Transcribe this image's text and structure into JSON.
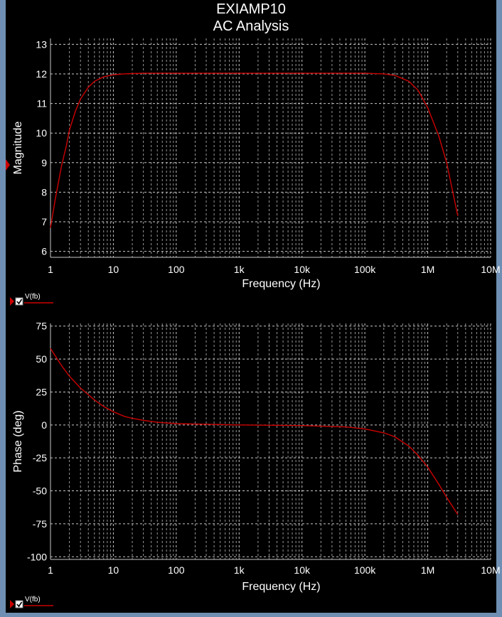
{
  "window": {
    "title": "EXIAMP10",
    "subtitle": "AC Analysis"
  },
  "colors": {
    "background": "#000000",
    "grid": "#c8c8c8",
    "trace": "#cc0000",
    "text": "#ffffff",
    "window_border": "#6e8fb3"
  },
  "chart_data": [
    {
      "type": "line",
      "xlabel": "Frequency (Hz)",
      "ylabel": "Magnitude",
      "xscale": "log",
      "xlim": [
        1,
        10000000
      ],
      "ylim": [
        5.8,
        13.2
      ],
      "x_ticks": [
        {
          "value": 1,
          "label": "1"
        },
        {
          "value": 10,
          "label": "10"
        },
        {
          "value": 100,
          "label": "100"
        },
        {
          "value": 1000,
          "label": "1k"
        },
        {
          "value": 10000,
          "label": "10k"
        },
        {
          "value": 100000,
          "label": "100k"
        },
        {
          "value": 1000000,
          "label": "1M"
        },
        {
          "value": 10000000,
          "label": "10M"
        }
      ],
      "y_ticks": [
        {
          "value": 6,
          "label": "6"
        },
        {
          "value": 7,
          "label": "7"
        },
        {
          "value": 8,
          "label": "8"
        },
        {
          "value": 9,
          "label": "9"
        },
        {
          "value": 10,
          "label": "10"
        },
        {
          "value": 11,
          "label": "11"
        },
        {
          "value": 12,
          "label": "12"
        },
        {
          "value": 13,
          "label": "13"
        }
      ],
      "grid": true,
      "legend_position": "bottom-left",
      "series": [
        {
          "name": "V(fb)",
          "x": [
            1,
            1.2,
            1.5,
            1.8,
            2,
            2.5,
            3,
            4,
            5,
            7,
            10,
            15,
            20,
            30,
            100,
            1000,
            10000,
            100000,
            200000,
            300000,
            500000,
            700000,
            1000000,
            1500000,
            2000000,
            2500000,
            3000000
          ],
          "y": [
            6.8,
            7.8,
            8.9,
            9.6,
            10.1,
            10.75,
            11.15,
            11.55,
            11.75,
            11.9,
            11.97,
            12.0,
            12.01,
            12.02,
            12.02,
            12.02,
            12.02,
            12.02,
            12.0,
            11.95,
            11.75,
            11.45,
            10.85,
            9.9,
            9.0,
            8.0,
            7.2
          ]
        }
      ]
    },
    {
      "type": "line",
      "xlabel": "Frequency (Hz)",
      "ylabel": "Phase (deg)",
      "xscale": "log",
      "xlim": [
        1,
        10000000
      ],
      "ylim": [
        -102,
        77
      ],
      "x_ticks": [
        {
          "value": 1,
          "label": "1"
        },
        {
          "value": 10,
          "label": "10"
        },
        {
          "value": 100,
          "label": "100"
        },
        {
          "value": 1000,
          "label": "1k"
        },
        {
          "value": 10000,
          "label": "10k"
        },
        {
          "value": 100000,
          "label": "100k"
        },
        {
          "value": 1000000,
          "label": "1M"
        },
        {
          "value": 10000000,
          "label": "10M"
        }
      ],
      "y_ticks": [
        {
          "value": 75,
          "label": "75"
        },
        {
          "value": 50,
          "label": "50"
        },
        {
          "value": 25,
          "label": "25"
        },
        {
          "value": 0,
          "label": "0"
        },
        {
          "value": -25,
          "label": "-25"
        },
        {
          "value": -50,
          "label": "-50"
        },
        {
          "value": -75,
          "label": "-75"
        },
        {
          "value": -100,
          "label": "-100"
        }
      ],
      "grid": true,
      "legend_position": "bottom-left",
      "series": [
        {
          "name": "V(fb)",
          "x": [
            1,
            1.5,
            2,
            3,
            5,
            7,
            10,
            15,
            20,
            30,
            50,
            100,
            1000,
            10000,
            50000,
            100000,
            200000,
            300000,
            500000,
            700000,
            1000000,
            1500000,
            2000000,
            3000000
          ],
          "y": [
            58,
            45,
            37,
            28,
            19,
            14,
            10,
            6.5,
            5,
            3.5,
            2,
            1,
            0,
            -0.5,
            -1.5,
            -3,
            -6,
            -9,
            -16,
            -23,
            -32,
            -45,
            -55,
            -68
          ]
        }
      ]
    }
  ]
}
